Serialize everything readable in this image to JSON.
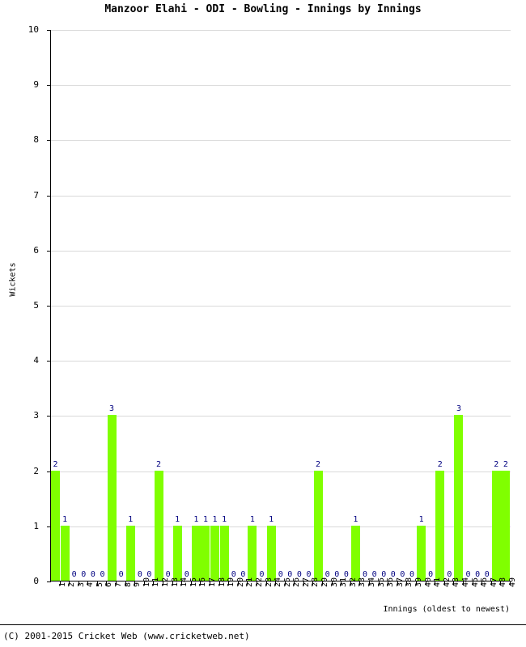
{
  "chart_data": {
    "type": "bar",
    "title": "Manzoor Elahi - ODI - Bowling - Innings by Innings",
    "xlabel": "Innings (oldest to newest)",
    "ylabel": "Wickets",
    "ylim": [
      0,
      10
    ],
    "ytick_labels": [
      "0",
      "1",
      "2",
      "3",
      "4",
      "5",
      "6",
      "7",
      "8",
      "9",
      "10"
    ],
    "ytick_values": [
      0,
      1,
      2,
      3,
      4,
      5,
      6,
      7,
      8,
      9,
      10
    ],
    "grid": true,
    "legend": "none",
    "bar_color": "#80ff00",
    "value_label_color": "#000080",
    "categories": [
      "1",
      "2",
      "3",
      "4",
      "5",
      "6",
      "7",
      "8",
      "9",
      "10",
      "11",
      "12",
      "13",
      "14",
      "15",
      "16",
      "17",
      "18",
      "19",
      "20",
      "21",
      "22",
      "23",
      "24",
      "25",
      "26",
      "27",
      "28",
      "29",
      "30",
      "31",
      "32",
      "33",
      "34",
      "35",
      "36",
      "37",
      "38",
      "39",
      "40",
      "41",
      "42",
      "43",
      "44",
      "45",
      "46",
      "47",
      "48",
      "49"
    ],
    "values": [
      2,
      1,
      0,
      0,
      0,
      0,
      3,
      0,
      1,
      0,
      0,
      2,
      0,
      1,
      0,
      1,
      1,
      1,
      1,
      0,
      0,
      1,
      0,
      1,
      0,
      0,
      0,
      0,
      2,
      0,
      0,
      0,
      1,
      0,
      0,
      0,
      0,
      0,
      0,
      1,
      0,
      2,
      0,
      3,
      0,
      0,
      0,
      2,
      2
    ],
    "series": [
      {
        "name": "Wickets",
        "values": [
          2,
          1,
          0,
          0,
          0,
          0,
          3,
          0,
          1,
          0,
          0,
          2,
          0,
          1,
          0,
          1,
          1,
          1,
          1,
          0,
          0,
          1,
          0,
          1,
          0,
          0,
          0,
          0,
          2,
          0,
          0,
          0,
          1,
          0,
          0,
          0,
          0,
          0,
          0,
          1,
          0,
          2,
          0,
          3,
          0,
          0,
          0,
          2,
          2
        ]
      }
    ]
  },
  "footer": {
    "copyright": "(C) 2001-2015 Cricket Web (www.cricketweb.net)"
  }
}
